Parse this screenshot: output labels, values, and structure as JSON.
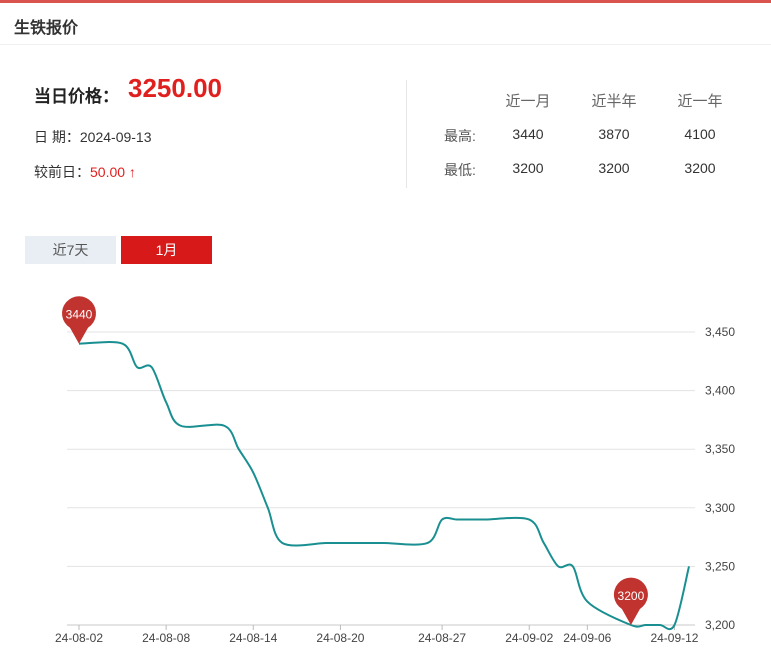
{
  "header": {
    "title": "生铁报价"
  },
  "price": {
    "label": "当日价格：",
    "value": "3250.00",
    "date_label": "日 期：",
    "date": "2024-09-13",
    "change_label": "较前日：",
    "change": "50.00 ↑"
  },
  "stats": {
    "headers": [
      "近一月",
      "近半年",
      "近一年"
    ],
    "rows": [
      {
        "label": "最高:",
        "values": [
          "3440",
          "3870",
          "4100"
        ]
      },
      {
        "label": "最低:",
        "values": [
          "3200",
          "3200",
          "3200"
        ]
      }
    ]
  },
  "tabs": [
    {
      "label": "近7天",
      "active": false
    },
    {
      "label": "1月",
      "active": true
    }
  ],
  "colors": {
    "accent": "#d7191a",
    "line": "#1a8f91",
    "marker": "#c0332f",
    "grid": "#e3e3e3"
  },
  "chart_data": {
    "type": "line",
    "x_ticks": [
      "24-08-02",
      "24-08-08",
      "24-08-14",
      "24-08-20",
      "24-08-27",
      "24-09-02",
      "24-09-06",
      "24-09-12"
    ],
    "y_ticks": [
      "3,450",
      "3,400",
      "3,350",
      "3,300",
      "3,250",
      "3,200"
    ],
    "ylim": [
      3200,
      3450
    ],
    "grid": true,
    "series": [
      {
        "x": [
          "24-08-02",
          "24-08-05",
          "24-08-06",
          "24-08-07",
          "24-08-08",
          "24-08-09",
          "24-08-12",
          "24-08-13",
          "24-08-14",
          "24-08-15",
          "24-08-16",
          "24-08-19",
          "24-08-20",
          "24-08-21",
          "24-08-22",
          "24-08-23",
          "24-08-26",
          "24-08-27",
          "24-08-28",
          "24-08-29",
          "24-08-30",
          "24-09-02",
          "24-09-03",
          "24-09-04",
          "24-09-05",
          "24-09-06",
          "24-09-09",
          "24-09-10",
          "24-09-11",
          "24-09-12",
          "24-09-13"
        ],
        "values": [
          3440,
          3440,
          3420,
          3420,
          3390,
          3370,
          3370,
          3350,
          3330,
          3300,
          3270,
          3270,
          3270,
          3270,
          3270,
          3270,
          3270,
          3290,
          3290,
          3290,
          3290,
          3290,
          3270,
          3250,
          3250,
          3220,
          3200,
          3200,
          3200,
          3200,
          3250
        ]
      }
    ],
    "markers": [
      {
        "label": "3440",
        "index": 0
      },
      {
        "label": "3200",
        "index": 26
      }
    ]
  }
}
